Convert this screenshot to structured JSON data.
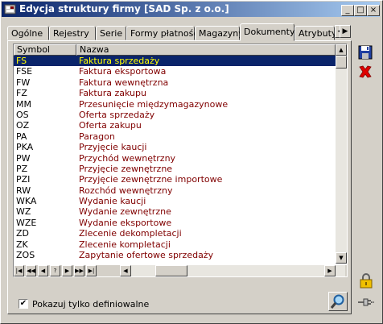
{
  "window": {
    "title": "Edycja struktury firmy [SAD Sp. z o.o.]"
  },
  "titlebar_buttons": {
    "minimize": "_",
    "maximize": "□",
    "close": "×"
  },
  "tabs": [
    {
      "label": "Ogólne",
      "active": false
    },
    {
      "label": "Rejestry",
      "active": false
    },
    {
      "label": "Serie",
      "active": false
    },
    {
      "label": "Formy płatności",
      "active": false
    },
    {
      "label": "Magazyny",
      "active": false
    },
    {
      "label": "Dokumenty",
      "active": true
    },
    {
      "label": "Atrybuty",
      "active": false
    }
  ],
  "tab_scroll": {
    "left": "◀",
    "right": "▶"
  },
  "table": {
    "columns": [
      "Symbol",
      "Nazwa"
    ],
    "rows": [
      [
        "FS",
        "Faktura sprzedaży"
      ],
      [
        "FSE",
        "Faktura eksportowa"
      ],
      [
        "FW",
        "Faktura wewnętrzna"
      ],
      [
        "FZ",
        "Faktura zakupu"
      ],
      [
        "MM",
        "Przesunięcie międzymagazynowe"
      ],
      [
        "OS",
        "Oferta sprzedaży"
      ],
      [
        "OZ",
        "Oferta zakupu"
      ],
      [
        "PA",
        "Paragon"
      ],
      [
        "PKA",
        "Przyjęcie kaucji"
      ],
      [
        "PW",
        "Przychód wewnętrzny"
      ],
      [
        "PZ",
        "Przyjęcie zewnętrzne"
      ],
      [
        "PZI",
        "Przyjęcie zewnętrzne importowe"
      ],
      [
        "RW",
        "Rozchód wewnętrzny"
      ],
      [
        "WKA",
        "Wydanie kaucji"
      ],
      [
        "WZ",
        "Wydanie zewnętrzne"
      ],
      [
        "WZE",
        "Wydanie eksportowe"
      ],
      [
        "ZD",
        "Zlecenie dekompletacji"
      ],
      [
        "ZK",
        "Zlecenie kompletacji"
      ],
      [
        "ZOS",
        "Zapytanie ofertowe sprzedaży"
      ]
    ],
    "selected_row": 0
  },
  "navigator": [
    "|◀",
    "◀◀",
    "◀",
    "?",
    "▶",
    "▶▶",
    "▶|"
  ],
  "scroll_arrows": {
    "up": "▲",
    "down": "▼",
    "left": "◀",
    "right": "▶"
  },
  "checkbox": {
    "label": "Pokazuj tylko definiowalne",
    "checked": true,
    "mark": "✔"
  },
  "colors": {
    "selection_bg": "#0a246a",
    "selection_text": "#ffff00",
    "name_text": "#800000"
  }
}
